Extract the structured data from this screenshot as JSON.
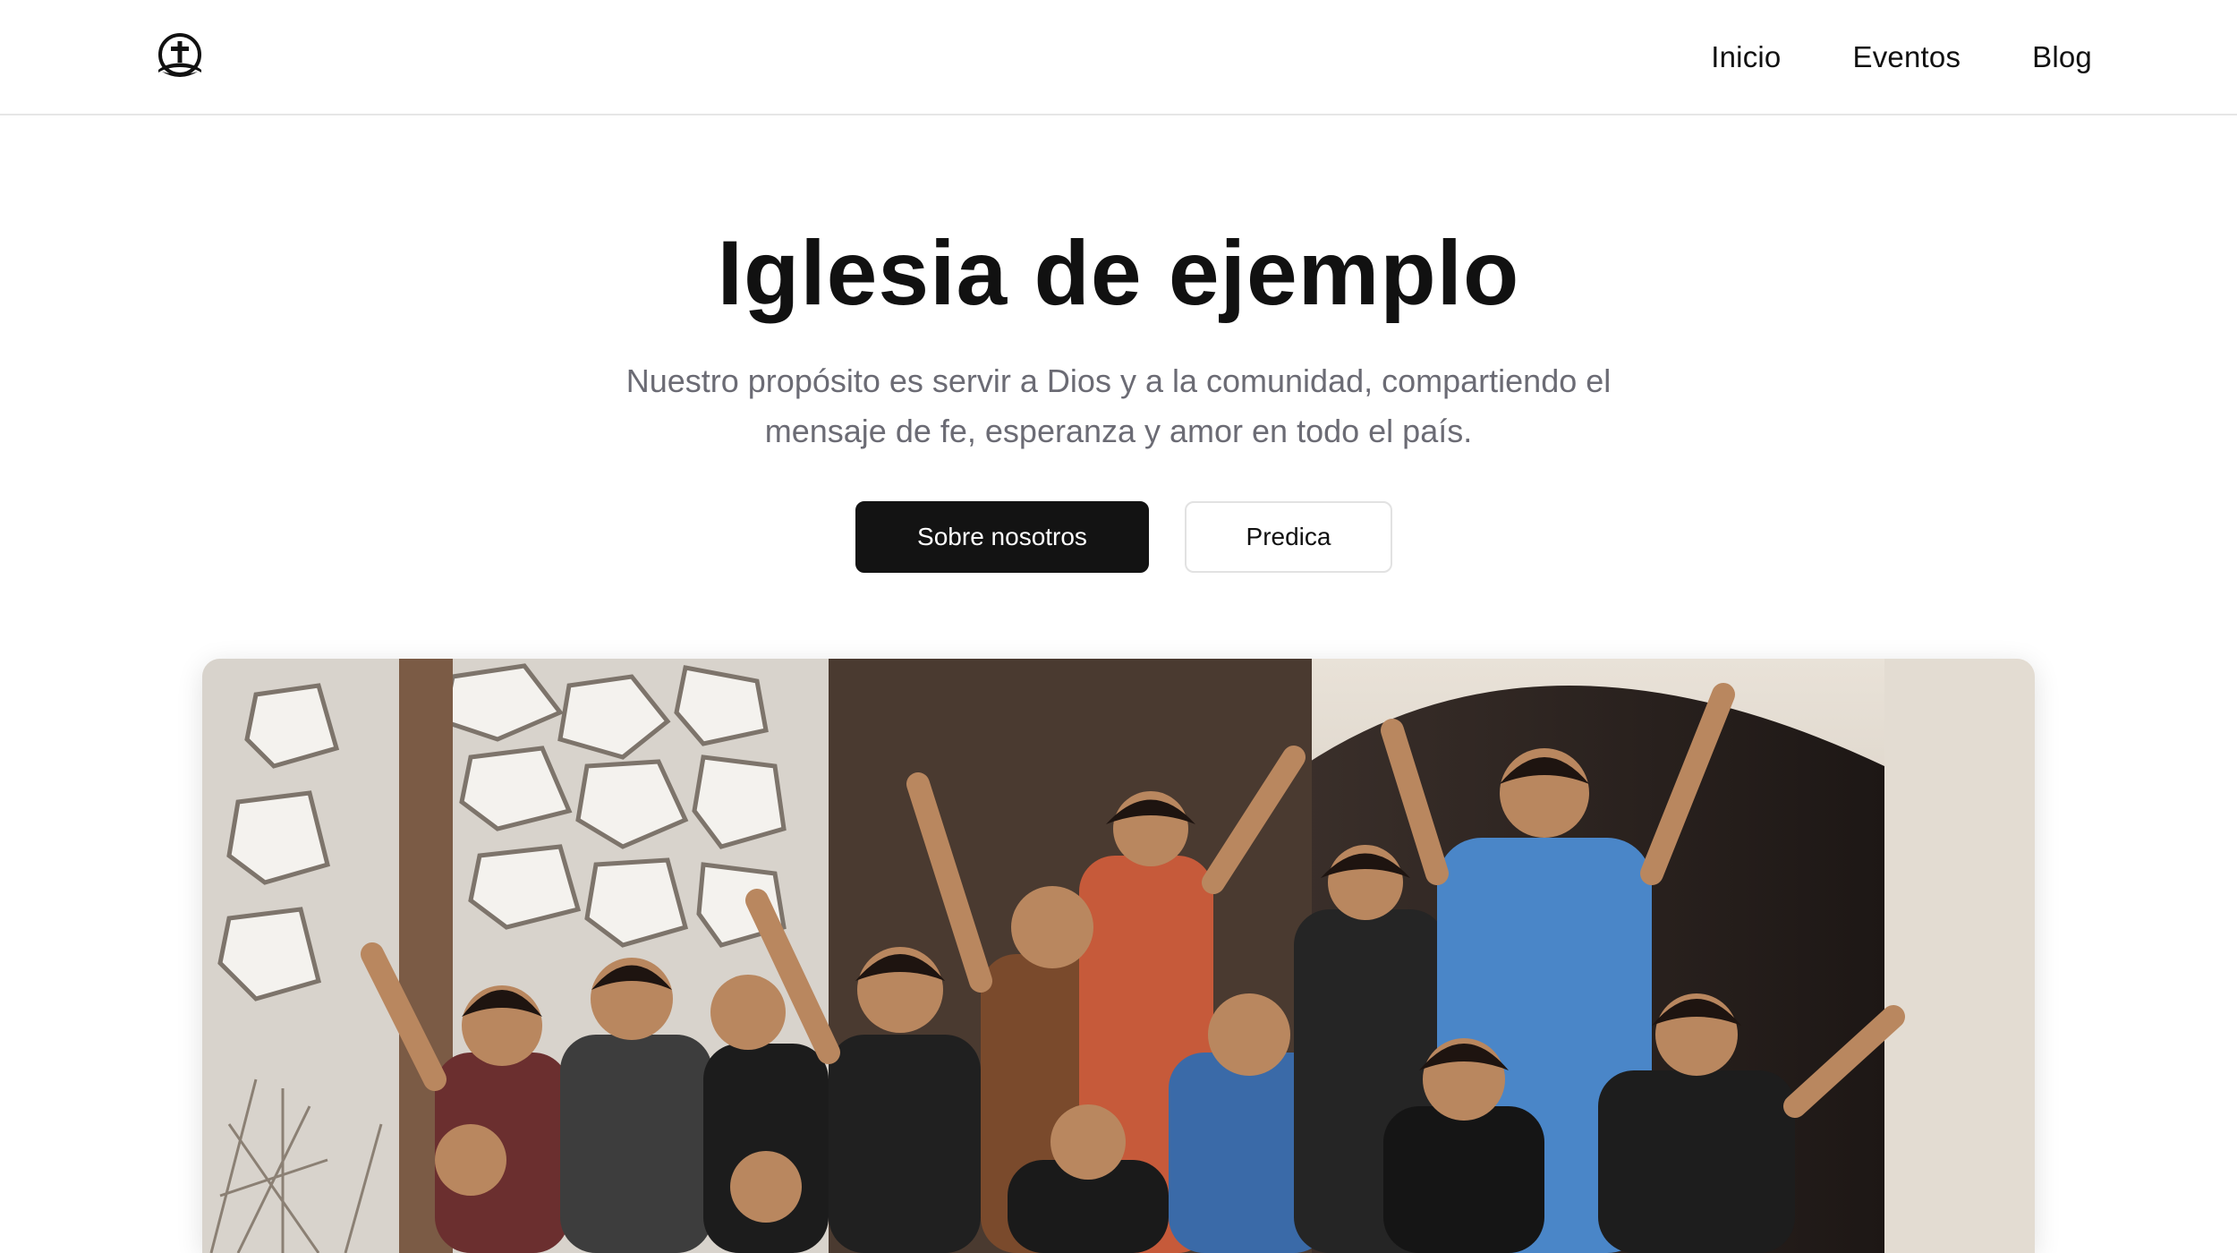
{
  "header": {
    "logo_icon": "church-cross-icon",
    "nav": [
      {
        "label": "Inicio"
      },
      {
        "label": "Eventos"
      },
      {
        "label": "Blog"
      }
    ]
  },
  "hero": {
    "title": "Iglesia de ejemplo",
    "subtitle": "Nuestro propósito es servir a Dios y a la comunidad, compartiendo el mensaje de fe, esperanza y amor en todo el país.",
    "primary_button": "Sobre nosotros",
    "secondary_button": "Predica"
  },
  "colors": {
    "primary_button_bg": "#131313",
    "subtitle_text": "#6b6b74",
    "border": "#e6e6e6"
  }
}
